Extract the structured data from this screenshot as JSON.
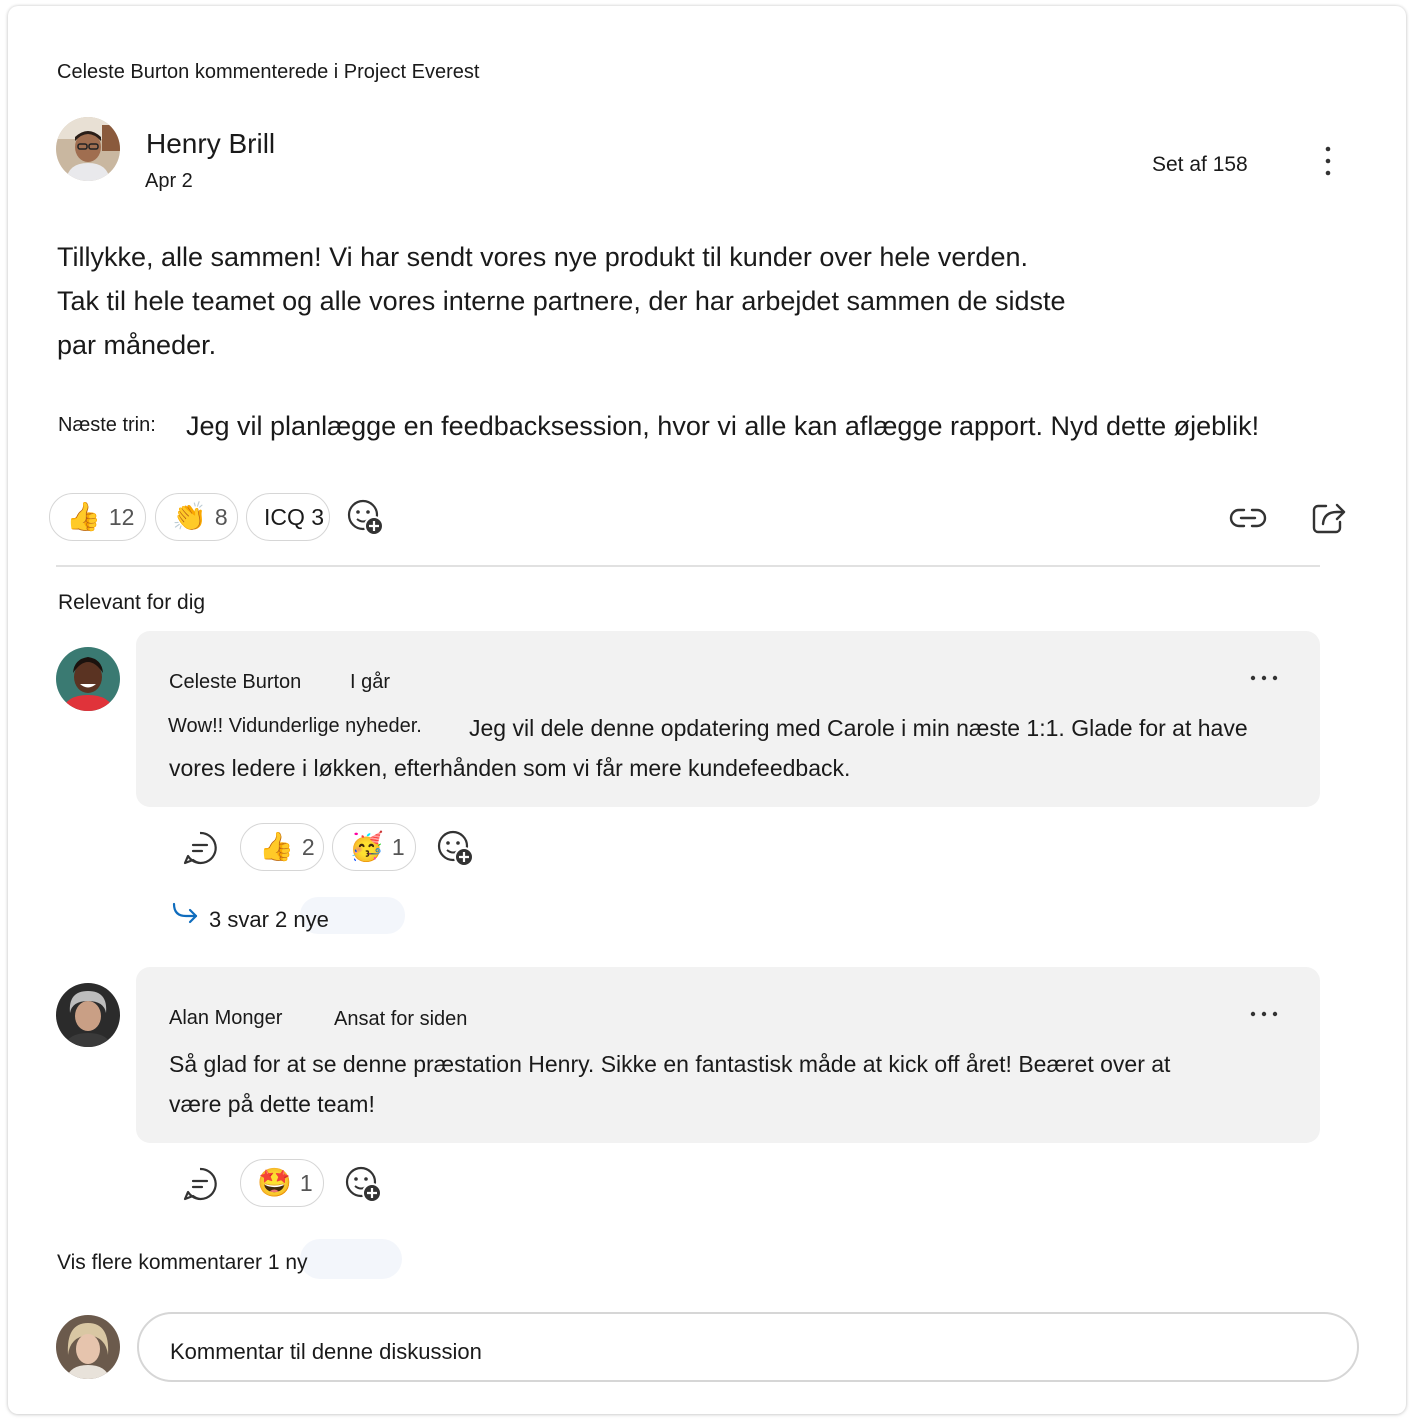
{
  "post": {
    "activity_line": "Celeste Burton kommenterede i Project Everest",
    "author": "Henry Brill",
    "date": "Apr 2",
    "seen_by": "Set af 158",
    "body_line1": "Tillykke, alle sammen! Vi har sendt vores nye produkt til kunder over hele verden.",
    "body_line2": "Tak til hele teamet og alle vores interne partnere, der har arbejdet sammen de sidste",
    "body_line3": "par måneder.",
    "next_step_label": "Næste trin:",
    "next_step_text": "Jeg vil planlægge en feedbacksession, hvor vi alle kan aflægge rapport. Nyd dette øjeblik!",
    "reactions": [
      {
        "icon": "thumbs-up-icon",
        "emoji": "👍",
        "count": "12"
      },
      {
        "icon": "clapping-hands-icon",
        "emoji": "👏",
        "count": "8"
      },
      {
        "icon": "icq-label",
        "emoji": "",
        "count": "ICQ 3"
      }
    ]
  },
  "section_label": "Relevant for dig",
  "comments": [
    {
      "author": "Celeste Burton",
      "meta": "I går",
      "lead": "Wow!! Vidunderlige nyheder.",
      "text_line1": "Jeg vil dele denne opdatering med Carole i min næste 1:1. Glade for at have",
      "text_line2": "vores ledere i løkken, efterhånden som vi får mere kundefeedback.",
      "reactions": [
        {
          "icon": "thumbs-up-icon",
          "emoji": "👍",
          "count": "2"
        },
        {
          "icon": "party-face-icon",
          "emoji": "🥳",
          "count": "1"
        }
      ],
      "replies": "3 svar 2 nye"
    },
    {
      "author": "Alan Monger",
      "meta": "Ansat for siden",
      "text_line1": "Så glad for at se denne præstation Henry. Sikke en fantastisk måde at kick off året! Beæret over at",
      "text_line2": "være på dette team!",
      "reactions": [
        {
          "icon": "star-struck-icon",
          "emoji": "🤩",
          "count": "1"
        }
      ]
    }
  ],
  "more_comments": "Vis flere kommentarer 1 ny",
  "composer": {
    "placeholder": "Kommentar til denne diskussion"
  },
  "colors": {
    "bubble": "#f2f2f2",
    "reply_arrow": "#0f6cbd",
    "border": "#d6d6d6"
  }
}
